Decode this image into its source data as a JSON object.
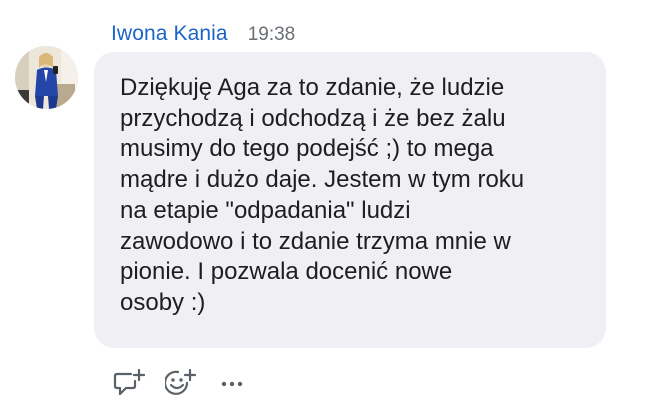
{
  "comment": {
    "author": "Iwona Kania",
    "time": "19:38",
    "text": "Dziękuję Aga za to zdanie, że ludzie\nprzychodzą i odchodzą i że bez żalu\nmusimy do tego podejść ;) to mega\nmądre i dużo daje. Jestem w tym roku\nna etapie \"odpadania\" ludzi\nzawodowo i to zdanie trzyma mnie w\npionie. I pozwala docenić nowe\nosoby :)"
  },
  "actions": [
    {
      "icon": "reply-comment-icon"
    },
    {
      "icon": "add-reaction-icon"
    },
    {
      "icon": "more-options-icon"
    }
  ],
  "colors": {
    "author": "#1b64c8",
    "time": "#6a6f75",
    "bubble": "#f0f0f4",
    "text": "#1c1e21",
    "icons": "#5b6168"
  }
}
